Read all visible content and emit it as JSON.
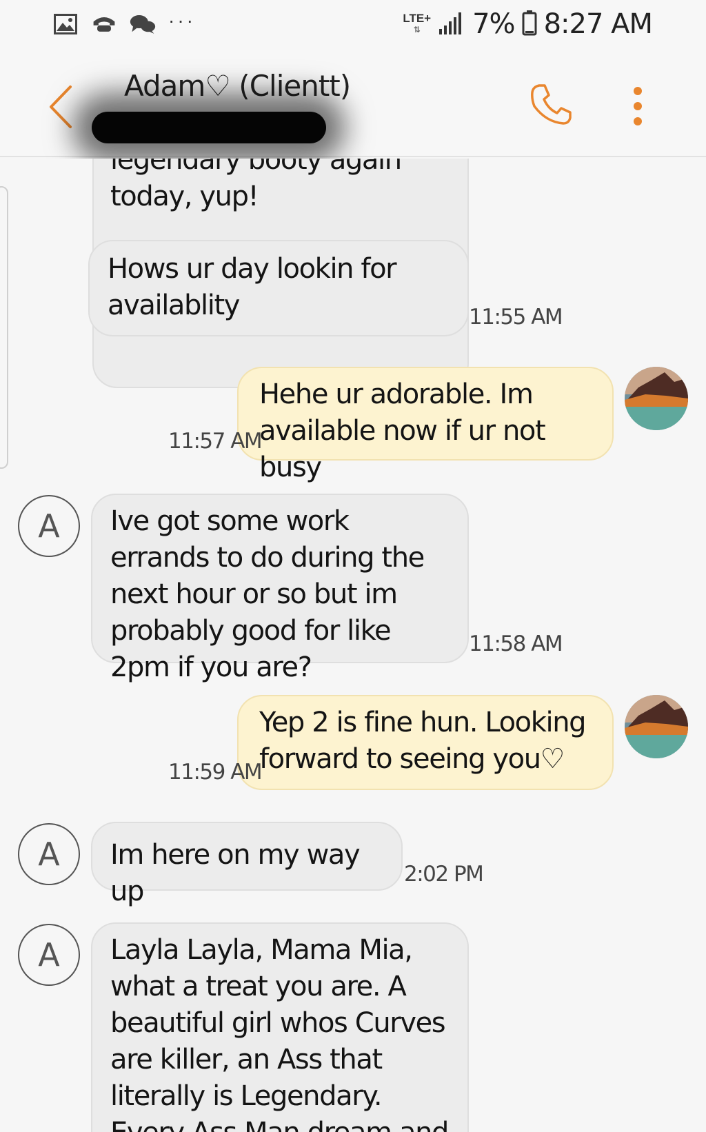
{
  "status_bar": {
    "icons": [
      "gallery-icon",
      "voicemail-icon",
      "chat-bubbles-icon"
    ],
    "more": "···",
    "network": "LTE+",
    "network_arrows": "⇅",
    "battery": "7%",
    "time": "8:27 AM"
  },
  "header": {
    "contact_name": "Adam♡ (Clientt)"
  },
  "colors": {
    "accent": "#e9862e",
    "incoming_bubble": "#ececec",
    "outgoing_bubble": "#fdf3d0",
    "background": "#f6f6f6"
  },
  "messages": [
    {
      "direction": "incoming",
      "text": "legendary booty again today, yup!",
      "time": ""
    },
    {
      "direction": "incoming",
      "text": "Hows ur day lookin for availablity",
      "time": "11:55 AM"
    },
    {
      "direction": "outgoing",
      "text": "Hehe ur adorable.  Im available now if ur not busy",
      "time": "11:57 AM"
    },
    {
      "direction": "incoming",
      "avatar": "A",
      "text": "Ive got some work errands to do during the next hour or so but im probably good for like 2pm if you are?",
      "time": "11:58 AM"
    },
    {
      "direction": "outgoing",
      "text": "Yep 2 is fine hun. Looking forward to seeing you♡",
      "time": "11:59 AM"
    },
    {
      "direction": "incoming",
      "avatar": "A",
      "text": "Im here on my way up",
      "time": "2:02 PM"
    },
    {
      "direction": "incoming",
      "avatar": "A",
      "text": "Layla Layla, Mama Mia, what a  treat you are. A beautiful girl whos Curves are killer, an Ass that literally is Legendary. Every Ass Man dream and a",
      "time": ""
    }
  ]
}
